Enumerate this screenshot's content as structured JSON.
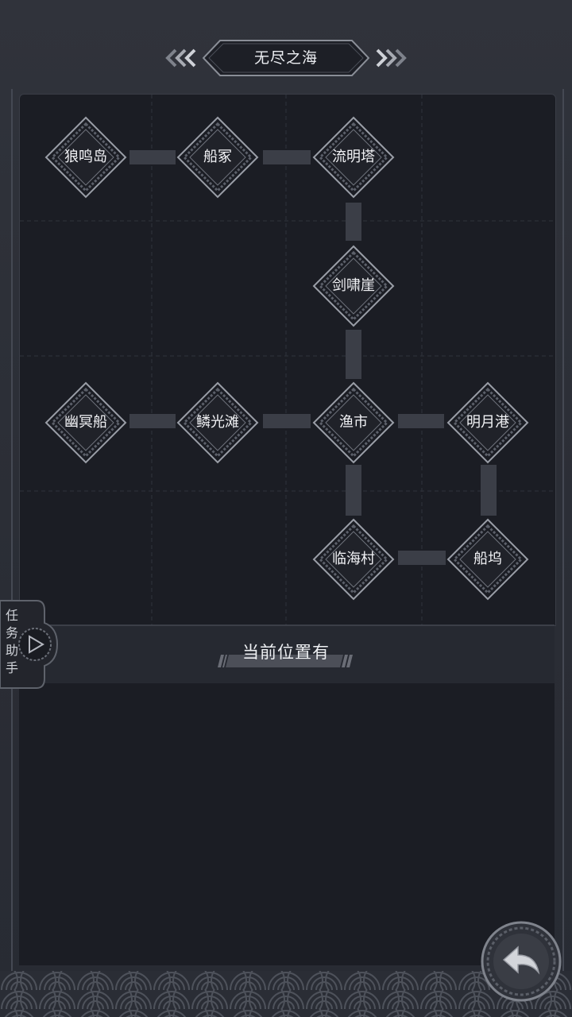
{
  "header": {
    "title": "无尽之海",
    "prev_icon": "double-chevron-left-icon",
    "next_icon": "double-chevron-right-icon"
  },
  "map": {
    "nodes": [
      {
        "id": "n1",
        "label": "狼鸣岛"
      },
      {
        "id": "n2",
        "label": "船冢"
      },
      {
        "id": "n3",
        "label": "流明塔"
      },
      {
        "id": "n4",
        "label": "剑啸崖"
      },
      {
        "id": "n5",
        "label": "幽冥船"
      },
      {
        "id": "n6",
        "label": "鳞光滩"
      },
      {
        "id": "n7",
        "label": "渔市"
      },
      {
        "id": "n8",
        "label": "明月港"
      },
      {
        "id": "n9",
        "label": "临海村"
      },
      {
        "id": "n10",
        "label": "船坞"
      }
    ]
  },
  "location": {
    "heading": "当前位置有"
  },
  "task_helper": {
    "chars": [
      "任",
      "务",
      "助",
      "手"
    ],
    "icon": "play-arrow-icon"
  },
  "footer": {
    "back_icon": "back-arrow-icon"
  },
  "colors": {
    "background": "#2b2e36",
    "map_bg": "#1b1d24",
    "node_border": "#8e929b",
    "text": "#f2f3f6"
  }
}
